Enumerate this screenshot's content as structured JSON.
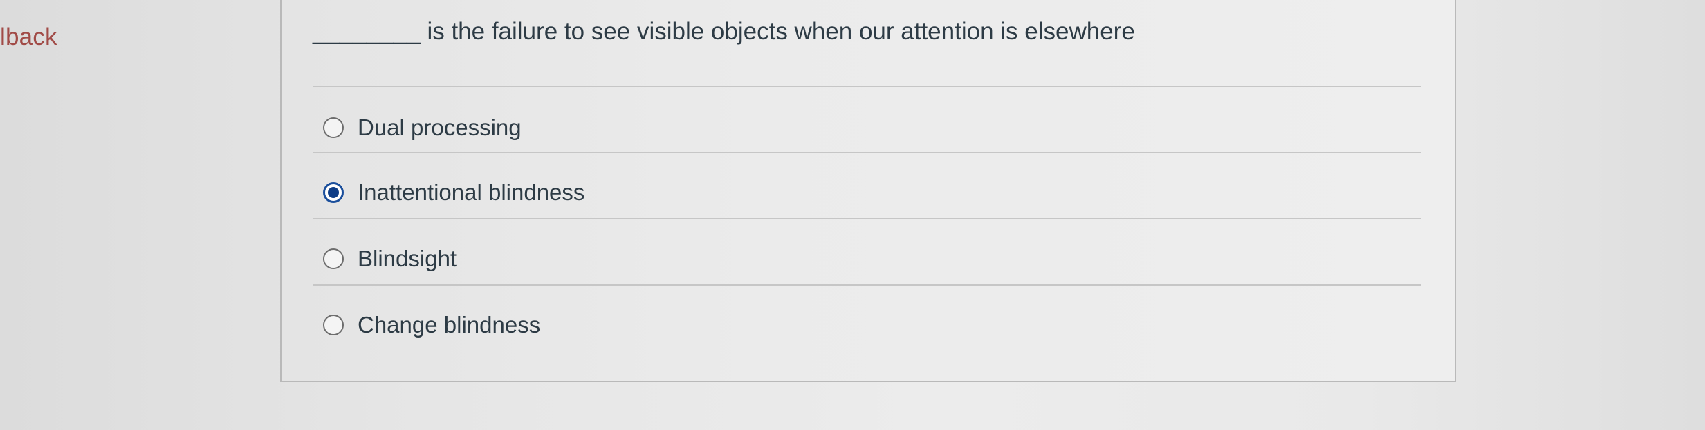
{
  "sidebar": {
    "link_text": "lback"
  },
  "question": {
    "text": "________ is the failure to see visible objects when our attention is elsewhere",
    "answers": [
      {
        "label": "Dual processing",
        "selected": false
      },
      {
        "label": "Inattentional blindness",
        "selected": true
      },
      {
        "label": "Blindsight",
        "selected": false
      },
      {
        "label": "Change blindness",
        "selected": false
      }
    ]
  },
  "colors": {
    "link": "#a14b47",
    "text": "#2d3b45",
    "radio_selected": "#0e3d87",
    "panel_border": "#b9b9b9"
  }
}
